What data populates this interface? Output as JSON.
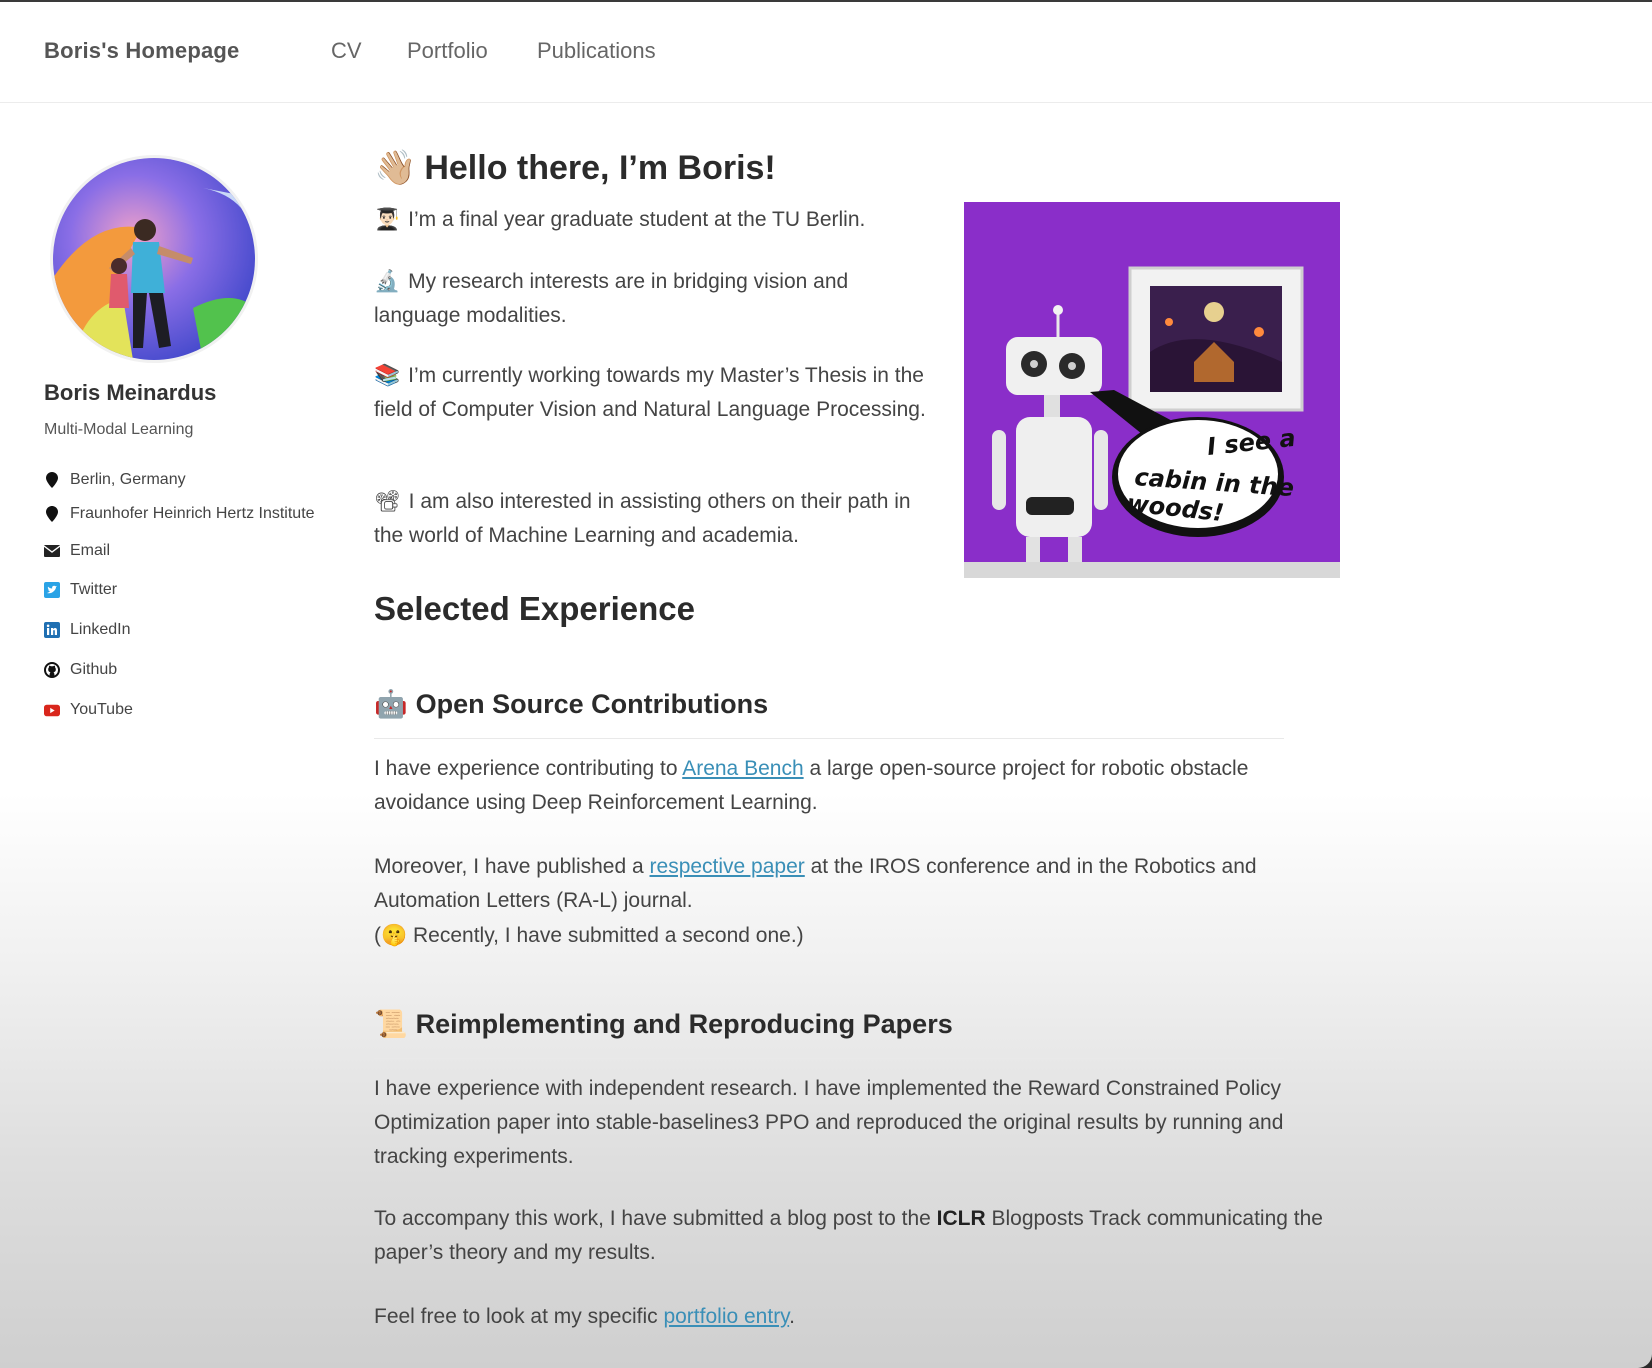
{
  "header": {
    "brand": "Boris's Homepage",
    "nav": [
      "CV",
      "Portfolio",
      "Publications"
    ]
  },
  "sidebar": {
    "name": "Boris Meinardus",
    "role": "Multi-Modal Learning",
    "items": [
      {
        "icon": "map-marker-icon",
        "label": "Berlin, Germany"
      },
      {
        "icon": "map-marker-icon",
        "label": "Fraunhofer Heinrich Hertz Institute"
      },
      {
        "icon": "envelope-icon",
        "label": "Email"
      },
      {
        "icon": "twitter-icon",
        "label": "Twitter"
      },
      {
        "icon": "linkedin-icon",
        "label": "LinkedIn"
      },
      {
        "icon": "github-icon",
        "label": "Github"
      },
      {
        "icon": "youtube-icon",
        "label": "YouTube"
      }
    ]
  },
  "main": {
    "title": "Hello there, I’m Boris!",
    "title_emoji": "👋🏼",
    "intro": [
      {
        "emoji": "👨🏻‍🎓",
        "text": "I’m a final year graduate student at the TU Berlin."
      },
      {
        "emoji": "🔬",
        "text": "My research interests are in bridging vision and language modalities."
      },
      {
        "emoji": "📚",
        "text": "I’m currently working towards my Master’s Thesis in the field of Computer Vision and Natural Language Processing."
      },
      {
        "emoji": "📽",
        "text": "I am also interested in assisting others on their path in the world of Machine Learning and academia."
      }
    ],
    "hero_speech": [
      "I see a",
      "cabin in the",
      "woods!"
    ],
    "section_title": "Selected Experience",
    "open_source": {
      "emoji": "🤖",
      "title": "Open Source Contributions",
      "p1_before": "I have experience contributing to ",
      "p1_link": "Arena Bench",
      "p1_after": " a large open-source project for robotic obstacle avoidance using Deep Reinforcement Learning.",
      "p2_before": "Moreover, I have published a ",
      "p2_link": "respective paper",
      "p2_after": " at the IROS conference and in the Robotics and Automation Letters (RA-L) journal.",
      "p3_open": "(",
      "p3_emoji": "🤫",
      "p3_text": " Recently, I have submitted a second one.)"
    },
    "reimpl": {
      "emoji": "📜",
      "title": "Reimplementing and Reproducing Papers",
      "p1": "I have experience with independent research. I have implemented the Reward Constrained Policy Optimization paper into stable-baselines3 PPO and reproduced the original results by running and tracking experiments.",
      "p2_before": "To accompany this work, I have submitted a blog post to the ",
      "p2_bold": "ICLR",
      "p2_after": " Blogposts Track communicating the paper’s theory and my results.",
      "p3_before": "Feel free to look at my specific ",
      "p3_link": "portfolio entry",
      "p3_after": "."
    }
  },
  "colors": {
    "link": "#3a8fb7",
    "hero_bg": "#8a2ec9",
    "text": "#444444"
  }
}
